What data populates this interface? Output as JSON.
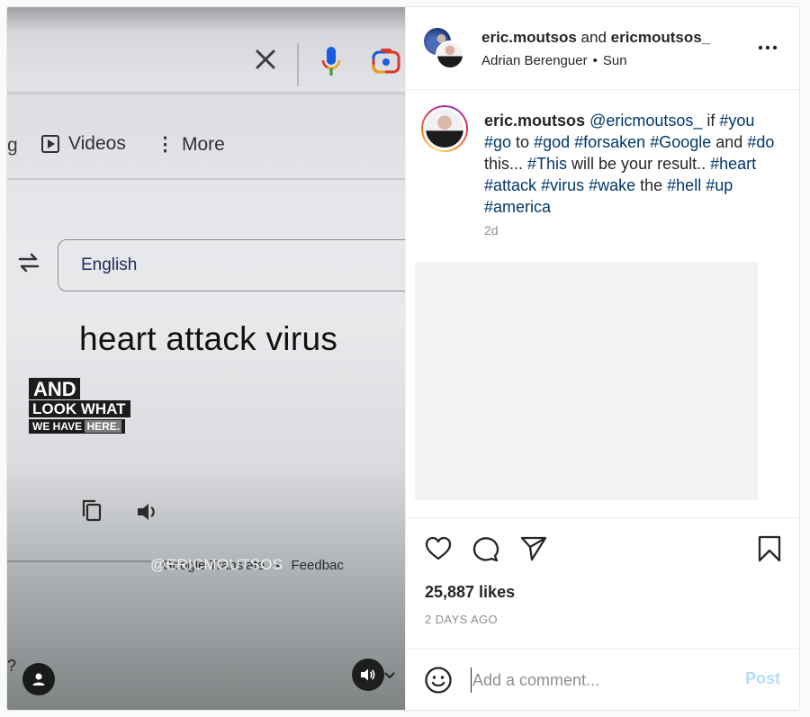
{
  "media": {
    "google_ui": {
      "tab_partial": "g",
      "tab_videos": "Videos",
      "tab_more": "More",
      "tab_more_dots": "⋮",
      "source_language": "English",
      "query_text": "heart attack virus",
      "footer_send_feedback": "Google Translate",
      "footer_dot": "•",
      "footer_feedback": "Feedbac",
      "question_mark": "?"
    },
    "overlay": {
      "line1": "AND",
      "line2": "LOOK WHAT",
      "line3_a": "WE HAVE ",
      "line3_b": "HERE."
    },
    "watermark": "@ERICMOUTSOS",
    "controls": {
      "tag_icon": "user-tag-icon",
      "audio_icon": "speaker-on-icon"
    }
  },
  "post": {
    "header": {
      "author_primary": "eric.moutsos",
      "connector": " and ",
      "author_secondary": "ericmoutsos_",
      "audio_credit": "Adrian Berenguer",
      "separator": "•",
      "posted_day": "Sun"
    },
    "caption": {
      "username": "eric.moutsos",
      "segments": [
        {
          "type": "mention",
          "text": "@ericmoutsos_"
        },
        {
          "type": "text",
          "text": " if "
        },
        {
          "type": "tag",
          "text": "#you"
        },
        {
          "type": "text",
          "text": " "
        },
        {
          "type": "tag",
          "text": "#go"
        },
        {
          "type": "text",
          "text": " to "
        },
        {
          "type": "tag",
          "text": "#god"
        },
        {
          "type": "text",
          "text": " "
        },
        {
          "type": "tag",
          "text": "#forsaken"
        },
        {
          "type": "text",
          "text": " "
        },
        {
          "type": "tag",
          "text": "#Google"
        },
        {
          "type": "text",
          "text": " and "
        },
        {
          "type": "tag",
          "text": "#do"
        },
        {
          "type": "text",
          "text": " this... "
        },
        {
          "type": "tag",
          "text": "#This"
        },
        {
          "type": "text",
          "text": " will be your result.. "
        },
        {
          "type": "tag",
          "text": "#heart"
        },
        {
          "type": "text",
          "text": " "
        },
        {
          "type": "tag",
          "text": "#attack"
        },
        {
          "type": "text",
          "text": " "
        },
        {
          "type": "tag",
          "text": "#virus"
        },
        {
          "type": "text",
          "text": " "
        },
        {
          "type": "tag",
          "text": "#wake"
        },
        {
          "type": "text",
          "text": " the "
        },
        {
          "type": "tag",
          "text": "#hell"
        },
        {
          "type": "text",
          "text": " "
        },
        {
          "type": "tag",
          "text": "#up"
        },
        {
          "type": "text",
          "text": " "
        },
        {
          "type": "tag",
          "text": "#america"
        }
      ],
      "time_ago": "2d"
    },
    "actions": {
      "like_icon": "heart-icon",
      "comment_icon": "comment-icon",
      "share_icon": "paper-plane-icon",
      "save_icon": "bookmark-icon"
    },
    "likes": "25,887 likes",
    "date": "2 DAYS AGO",
    "comment_box": {
      "placeholder": "Add a comment...",
      "value": "",
      "post_label": "Post"
    }
  },
  "colors": {
    "link": "#00376b",
    "post_button_disabled": "#b2dffc",
    "muted_text": "#8e8e8e"
  }
}
